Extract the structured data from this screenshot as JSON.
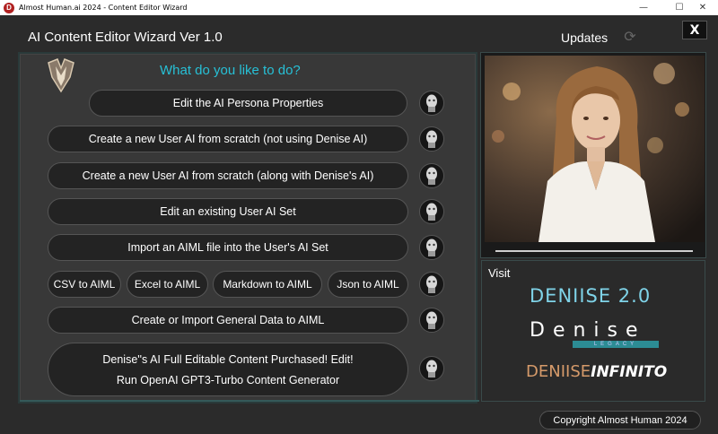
{
  "window": {
    "title": "Almost Human.ai 2024 - Content Editor Wizard",
    "minimize": "—",
    "maximize": "☐",
    "close": "✕"
  },
  "header": {
    "app_title": "AI Content Editor Wizard  Ver 1.0",
    "updates_label": "Updates",
    "close_label": "X"
  },
  "main": {
    "question": "What do you like to do?",
    "buttons": {
      "edit_persona": "Edit the AI Persona Properties",
      "new_user_ai": "Create a new User AI from scratch (not using Denise AI)",
      "new_user_ai_denise": "Create a new User AI from scratch (along with Denise's AI)",
      "edit_existing": "Edit an existing User AI Set",
      "import_aiml": "Import an AIML file into the User's AI Set",
      "csv": "CSV to AIML",
      "excel": "Excel to AIML",
      "markdown": "Markdown to AIML",
      "json": "Json to AIML",
      "general_data": "Create or Import General Data to AIML",
      "purchased_line1": "Denise''s AI Full Editable Content Purchased! Edit!",
      "purchased_line2": "Run OpenAI GPT3-Turbo Content Generator"
    }
  },
  "visit": {
    "label": "Visit",
    "logo1": "DENIISE 2.0",
    "logo2_main": "Denise",
    "logo2_sub": "LEGACY",
    "logo3_a": "DENIISE",
    "logo3_b": "INFINITO"
  },
  "footer": {
    "copyright": "Copyright Almost Human 2024"
  },
  "colors": {
    "background": "#2b2b2b",
    "panel": "#383838",
    "accent_cyan": "#27c0d6",
    "button": "#232323"
  }
}
